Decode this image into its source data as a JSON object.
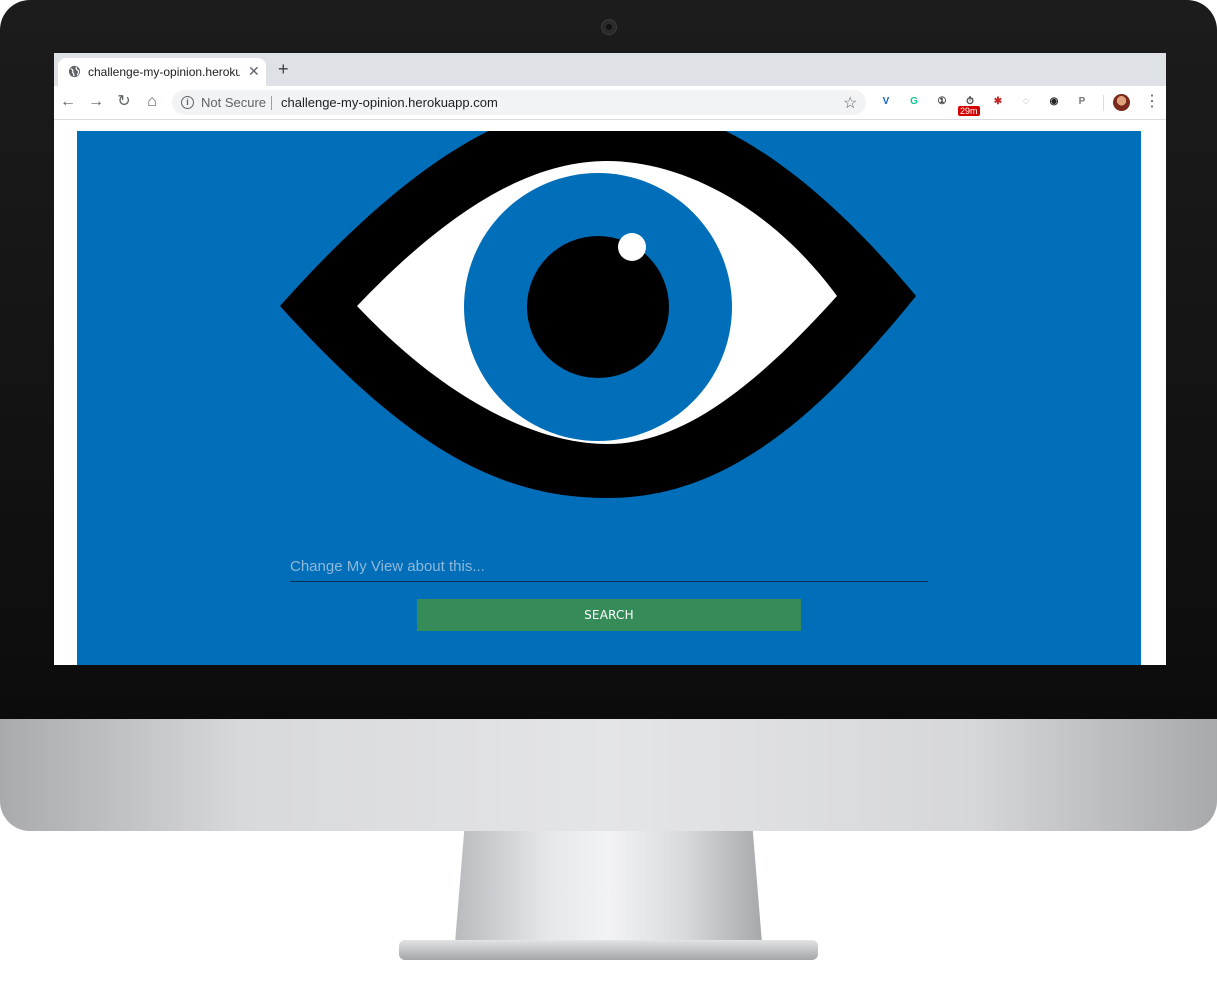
{
  "browser": {
    "tab": {
      "title": "challenge-my-opinion.herokuapp.com",
      "icon": "globe-icon",
      "close_glyph": "✕"
    },
    "new_tab_glyph": "+",
    "nav": {
      "back": "←",
      "forward": "→",
      "reload": "↻",
      "home": "⌂"
    },
    "omnibox": {
      "security_icon": "info-icon",
      "security_glyph": "i",
      "security_label": "Not Secure",
      "url": "challenge-my-opinion.herokuapp.com",
      "bookmark_glyph": "☆"
    },
    "extensions": [
      {
        "name": "vee-extension-icon",
        "glyph": "V",
        "color": "#1565c0"
      },
      {
        "name": "grammarly-icon",
        "glyph": "G",
        "color": "#15c39a"
      },
      {
        "name": "onepassword-icon",
        "glyph": "①",
        "color": "#333333"
      },
      {
        "name": "timer-extension-icon",
        "glyph": "⏱",
        "color": "#444444",
        "badge": "29m"
      },
      {
        "name": "red-extension-icon",
        "glyph": "✱",
        "color": "#c62828"
      },
      {
        "name": "privacy-extension-icon",
        "glyph": "◌",
        "color": "#888888"
      },
      {
        "name": "screen-capture-icon",
        "glyph": "◉",
        "color": "#222222"
      },
      {
        "name": "p-extension-icon",
        "glyph": "P",
        "color": "#777777"
      }
    ],
    "menu_glyph": "⋮"
  },
  "page": {
    "background": "#006eb9",
    "iris_color": "#006eb9",
    "search": {
      "placeholder": "Change My View about this...",
      "value": ""
    },
    "button_label": "SEARCH",
    "button_color": "#368c59"
  }
}
